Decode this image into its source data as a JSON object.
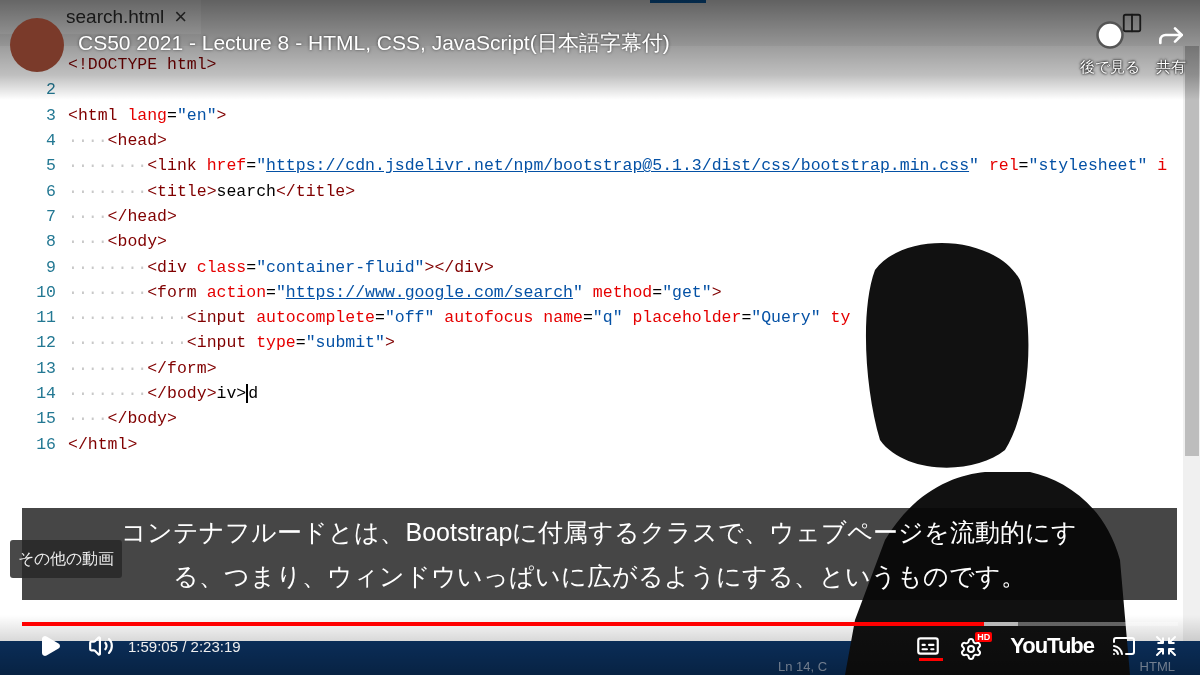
{
  "editor": {
    "tab": {
      "label": "search.html",
      "close": "×"
    },
    "lines": [
      {
        "tokens": [
          {
            "kind": "tag",
            "text": "<!DOCTYPE html>"
          }
        ]
      },
      {
        "number": "2"
      },
      {
        "number": "3",
        "tokens": [
          {
            "kind": "tag",
            "text": "<html"
          },
          {
            "kind": "attr",
            "text": " lang"
          },
          {
            "kind": "text",
            "text": "="
          },
          {
            "kind": "string",
            "text": "\"en\""
          },
          {
            "kind": "tag",
            "text": ">"
          }
        ]
      },
      {
        "number": "4",
        "tokens": [
          {
            "kind": "dots",
            "text": "····"
          },
          {
            "kind": "tag",
            "text": "<head>"
          }
        ]
      },
      {
        "number": "5",
        "tokens": [
          {
            "kind": "dots",
            "text": "········"
          },
          {
            "kind": "tag",
            "text": "<link"
          },
          {
            "kind": "attr",
            "text": " href"
          },
          {
            "kind": "text",
            "text": "="
          },
          {
            "kind": "string",
            "text": "\""
          },
          {
            "kind": "link",
            "text": "https://cdn.jsdelivr.net/npm/bootstrap@5.1.3/dist/css/bootstrap.min.css"
          },
          {
            "kind": "string",
            "text": "\""
          },
          {
            "kind": "attr",
            "text": " rel"
          },
          {
            "kind": "text",
            "text": "="
          },
          {
            "kind": "string",
            "text": "\"stylesheet\""
          },
          {
            "kind": "attr",
            "text": " i"
          }
        ]
      },
      {
        "number": "6",
        "tokens": [
          {
            "kind": "dots",
            "text": "········"
          },
          {
            "kind": "tag",
            "text": "<title>"
          },
          {
            "kind": "text",
            "text": "search"
          },
          {
            "kind": "tag",
            "text": "</title>"
          }
        ]
      },
      {
        "number": "7",
        "tokens": [
          {
            "kind": "dots",
            "text": "····"
          },
          {
            "kind": "tag",
            "text": "</head>"
          }
        ]
      },
      {
        "number": "8",
        "tokens": [
          {
            "kind": "dots",
            "text": "····"
          },
          {
            "kind": "tag",
            "text": "<body>"
          }
        ]
      },
      {
        "number": "9",
        "tokens": [
          {
            "kind": "dots",
            "text": "········"
          },
          {
            "kind": "tag",
            "text": "<div"
          },
          {
            "kind": "attr",
            "text": " class"
          },
          {
            "kind": "text",
            "text": "="
          },
          {
            "kind": "string",
            "text": "\"container-fluid\""
          },
          {
            "kind": "tag",
            "text": "></div>"
          }
        ]
      },
      {
        "number": "10",
        "tokens": [
          {
            "kind": "dots",
            "text": "········"
          },
          {
            "kind": "tag",
            "text": "<form"
          },
          {
            "kind": "attr",
            "text": " action"
          },
          {
            "kind": "text",
            "text": "="
          },
          {
            "kind": "string",
            "text": "\""
          },
          {
            "kind": "link",
            "text": "https://www.google.com/search"
          },
          {
            "kind": "string",
            "text": "\""
          },
          {
            "kind": "attr",
            "text": " method"
          },
          {
            "kind": "text",
            "text": "="
          },
          {
            "kind": "string",
            "text": "\"get\""
          },
          {
            "kind": "tag",
            "text": ">"
          }
        ]
      },
      {
        "number": "11",
        "tokens": [
          {
            "kind": "dots",
            "text": "············"
          },
          {
            "kind": "tag",
            "text": "<input"
          },
          {
            "kind": "attr",
            "text": " autocomplete"
          },
          {
            "kind": "text",
            "text": "="
          },
          {
            "kind": "string",
            "text": "\"off\""
          },
          {
            "kind": "attr",
            "text": " autofocus name"
          },
          {
            "kind": "text",
            "text": "="
          },
          {
            "kind": "string",
            "text": "\"q\""
          },
          {
            "kind": "attr",
            "text": " placeholder"
          },
          {
            "kind": "text",
            "text": "="
          },
          {
            "kind": "string",
            "text": "\"Query\""
          },
          {
            "kind": "attr",
            "text": " ty"
          }
        ]
      },
      {
        "number": "12",
        "tokens": [
          {
            "kind": "dots",
            "text": "············"
          },
          {
            "kind": "tag",
            "text": "<input"
          },
          {
            "kind": "attr",
            "text": " type"
          },
          {
            "kind": "text",
            "text": "="
          },
          {
            "kind": "string",
            "text": "\"submit\""
          },
          {
            "kind": "tag",
            "text": ">"
          }
        ]
      },
      {
        "number": "13",
        "tokens": [
          {
            "kind": "dots",
            "text": "········"
          },
          {
            "kind": "tag",
            "text": "</form>"
          }
        ]
      },
      {
        "number": "14",
        "tokens": [
          {
            "kind": "dots",
            "text": "········"
          },
          {
            "kind": "tag",
            "text": "</body>"
          },
          {
            "kind": "text",
            "text": "iv>"
          },
          {
            "kind": "cursor"
          },
          {
            "kind": "text",
            "text": "d"
          }
        ]
      },
      {
        "number": "15",
        "tokens": [
          {
            "kind": "dots",
            "text": "····"
          },
          {
            "kind": "tag",
            "text": "</body>"
          }
        ]
      },
      {
        "number": "16",
        "tokens": [
          {
            "kind": "tag",
            "text": "</html>"
          }
        ]
      }
    ],
    "status_bar": {
      "position": "Ln 14, C",
      "language": "HTML"
    }
  },
  "video": {
    "title": "CS50 2021 - Lecture 8 - HTML, CSS, JavaScript(日本語字幕付)",
    "actions": [
      {
        "kind": "watch_later",
        "label": "後で見る"
      },
      {
        "kind": "share",
        "label": "共有"
      }
    ],
    "captions": [
      "コンテナフルードとは、Bootstrapに付属するクラスで、ウェブページを流動的にす",
      "る、つまり、ウィンドウいっぱいに広がるようにする、というものです。"
    ],
    "more_videos": "その他の動画",
    "progress": {
      "level": 0.832
    },
    "time": "1:59:05 / 2:23:19",
    "captions_on": true,
    "hd_badge": "HD",
    "logo": "YouTube"
  }
}
